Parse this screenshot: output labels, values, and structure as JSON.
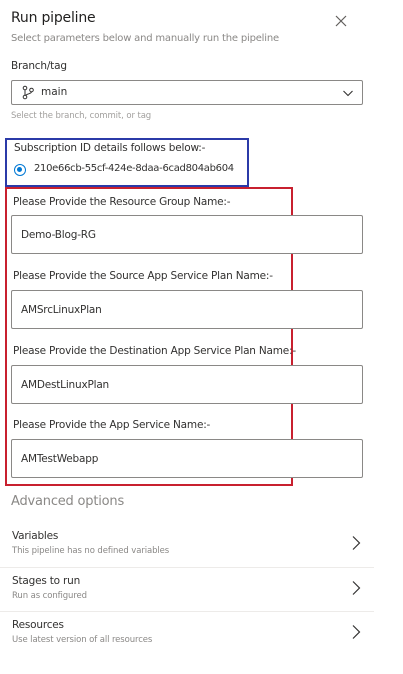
{
  "header": {
    "title": "Run pipeline",
    "subtitle": "Select parameters below and manually run the pipeline"
  },
  "branch": {
    "label": "Branch/tag",
    "value": "main",
    "hint": "Select the branch, commit, or tag"
  },
  "subscription": {
    "label": "Subscription ID details follows below:-",
    "option": "210e66cb-55cf-424e-8daa-6cad804ab604",
    "selected": true,
    "highlight_color": "#2b3aa8"
  },
  "parameters": {
    "highlight_color": "#c8202f",
    "resource_group": {
      "label": "Please Provide the Resource Group Name:-",
      "value": "Demo-Blog-RG"
    },
    "source_plan": {
      "label": "Please Provide the Source App Service Plan Name:-",
      "value": "AMSrcLinuxPlan"
    },
    "dest_plan": {
      "label": "Please Provide the Destination App Service Plan Name:-",
      "value": "AMDestLinuxPlan"
    },
    "app_service": {
      "label": "Please Provide the App Service Name:-",
      "value": "AMTestWebapp"
    }
  },
  "advanced": {
    "title": "Advanced options",
    "options": [
      {
        "title": "Variables",
        "description": "This pipeline has no defined variables"
      },
      {
        "title": "Stages to run",
        "description": "Run as configured"
      },
      {
        "title": "Resources",
        "description": "Use latest version of all resources"
      }
    ]
  },
  "icons": {
    "close": "close-icon",
    "branch": "git-branch-icon",
    "dropdown": "chevron-down-icon",
    "option": "chevron-right-icon"
  },
  "colors": {
    "accent": "#0078d4"
  }
}
